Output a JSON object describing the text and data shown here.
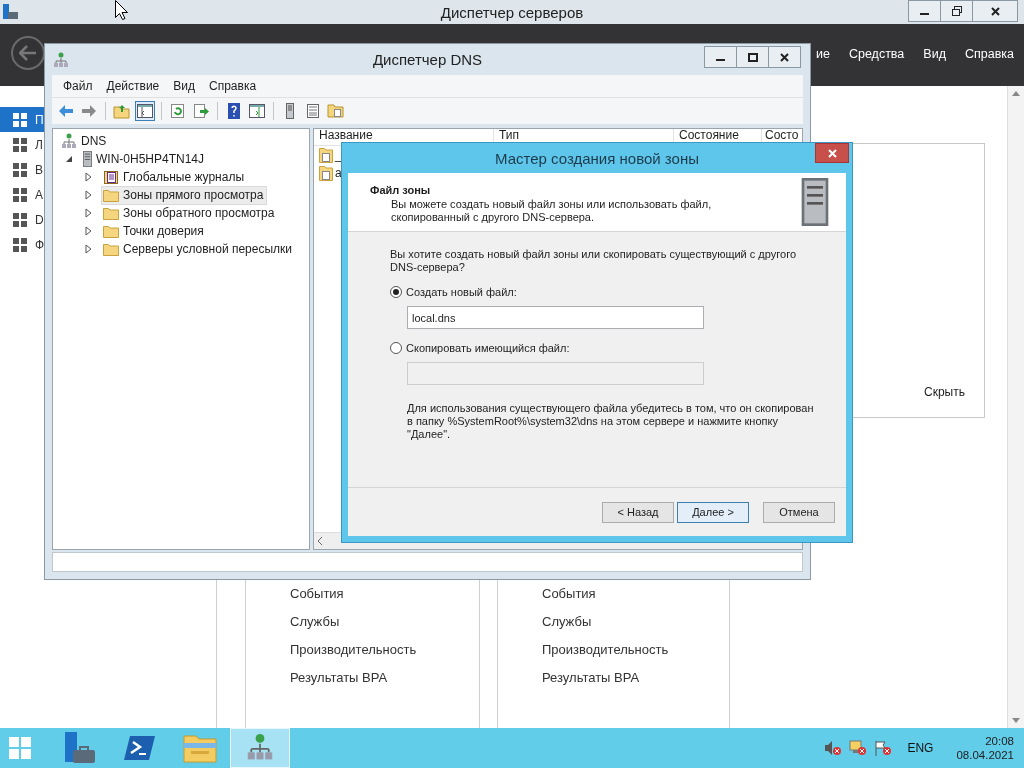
{
  "server_manager": {
    "title": "Диспетчер серверов",
    "menu": [
      "ие",
      "Средства",
      "Вид",
      "Справка"
    ],
    "nav": [
      {
        "label": "П",
        "selected": true
      },
      {
        "label": "Л",
        "selected": false
      },
      {
        "label": "В",
        "selected": false
      },
      {
        "label": "А",
        "selected": false
      },
      {
        "label": "D",
        "selected": false
      },
      {
        "label": "Ф",
        "selected": false
      }
    ],
    "hide_link": "Скрыть",
    "tiles": [
      {
        "items": [
          "События",
          "Службы",
          "Производительность",
          "Результаты BPA"
        ]
      },
      {
        "items": [
          "События",
          "Службы",
          "Производительность",
          "Результаты BPA"
        ]
      }
    ]
  },
  "dns_window": {
    "title": "Диспетчер DNS",
    "menu": [
      "Файл",
      "Действие",
      "Вид",
      "Справка"
    ],
    "toolbar": [
      {
        "kind": "back",
        "selected": false
      },
      {
        "kind": "forward",
        "selected": false
      },
      {
        "kind": "up",
        "selected": false
      },
      {
        "kind": "tree",
        "selected": true
      },
      {
        "kind": "refresh",
        "selected": false
      },
      {
        "kind": "export",
        "selected": false
      },
      {
        "kind": "help",
        "selected": false
      },
      {
        "kind": "panel",
        "selected": false
      },
      {
        "kind": "server",
        "selected": false
      },
      {
        "kind": "list",
        "selected": false
      },
      {
        "kind": "zone",
        "selected": false
      }
    ],
    "tree": [
      {
        "label": "DNS",
        "kind": "root",
        "selected": false,
        "children": [
          {
            "label": "WIN-0H5HP4TN14J",
            "kind": "server",
            "expanded": true,
            "selected": false,
            "children": [
              {
                "label": "Глобальные журналы",
                "kind": "log",
                "expanded": false,
                "selected": false
              },
              {
                "label": "Зоны прямого просмотра",
                "kind": "folder",
                "expanded": false,
                "selected": true
              },
              {
                "label": "Зоны обратного просмотра",
                "kind": "folder",
                "expanded": false,
                "selected": false
              },
              {
                "label": "Точки доверия",
                "kind": "folder",
                "expanded": false,
                "selected": false
              },
              {
                "label": "Серверы условной пересылки",
                "kind": "folder",
                "expanded": false,
                "selected": false
              }
            ]
          }
        ]
      }
    ],
    "columns": [
      "Название",
      "Тип",
      "Состояние",
      "Состо"
    ],
    "rows": [
      {
        "name": "_"
      },
      {
        "name": "a"
      }
    ]
  },
  "wizard": {
    "title": "Мастер создания новой зоны",
    "heading": "Файл зоны",
    "subheading": "Вы можете создать новый файл зоны или использовать файл, скопированный с другого DNS-сервера.",
    "question": "Вы хотите создать новый файл зоны или скопировать существующий с другого DNS-сервера?",
    "options": [
      {
        "label": "Создать новый файл:",
        "selected": true,
        "field": {
          "value": "local.dns",
          "disabled": false
        }
      },
      {
        "label": "Скопировать имеющийся файл:",
        "selected": false,
        "field": {
          "disabled": true
        }
      }
    ],
    "note": "Для использования существующего файла убедитесь в том, что он скопирован в папку %SystemRoot%\\system32\\dns на этом сервере и нажмите кнопку \"Далее\".",
    "buttons": [
      {
        "label": "< Назад",
        "default": false
      },
      {
        "label": "Далее >",
        "default": true
      },
      {
        "label": "Отмена",
        "default": false
      }
    ]
  },
  "taskbar": {
    "apps": [
      {
        "kind": "server-manager",
        "selected": false
      },
      {
        "kind": "powershell",
        "selected": false
      },
      {
        "kind": "explorer",
        "selected": false
      },
      {
        "kind": "dns",
        "selected": true
      }
    ],
    "language": "ENG",
    "time": "20:08",
    "date": "08.04.2021"
  }
}
